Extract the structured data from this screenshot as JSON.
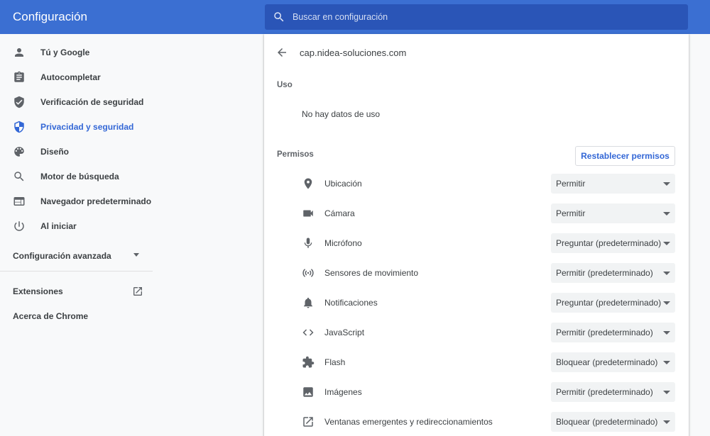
{
  "header": {
    "title": "Configuración",
    "search_placeholder": "Buscar en configuración"
  },
  "sidebar": {
    "items": [
      {
        "label": "Tú y Google",
        "icon": "person-icon"
      },
      {
        "label": "Autocompletar",
        "icon": "clipboard-icon"
      },
      {
        "label": "Verificación de seguridad",
        "icon": "shield-check-icon"
      },
      {
        "label": "Privacidad y seguridad",
        "icon": "shield-privacy-icon",
        "active": true
      },
      {
        "label": "Diseño",
        "icon": "palette-icon"
      },
      {
        "label": "Motor de búsqueda",
        "icon": "search-icon"
      },
      {
        "label": "Navegador predeterminado",
        "icon": "browser-icon"
      },
      {
        "label": "Al iniciar",
        "icon": "power-icon"
      }
    ],
    "advanced": "Configuración avanzada",
    "extensions": "Extensiones",
    "about": "Acerca de Chrome"
  },
  "main": {
    "site": "cap.nidea-soluciones.com",
    "usage_title": "Uso",
    "usage_text": "No hay datos de uso",
    "permissions_title": "Permisos",
    "reset_label": "Restablecer permisos",
    "permissions": [
      {
        "label": "Ubicación",
        "value": "Permitir",
        "icon": "location-icon"
      },
      {
        "label": "Cámara",
        "value": "Permitir",
        "icon": "camera-icon"
      },
      {
        "label": "Micrófono",
        "value": "Preguntar (predeterminado)",
        "icon": "microphone-icon"
      },
      {
        "label": "Sensores de movimiento",
        "value": "Permitir (predeterminado)",
        "icon": "sensors-icon"
      },
      {
        "label": "Notificaciones",
        "value": "Preguntar (predeterminado)",
        "icon": "bell-icon"
      },
      {
        "label": "JavaScript",
        "value": "Permitir (predeterminado)",
        "icon": "code-icon"
      },
      {
        "label": "Flash",
        "value": "Bloquear (predeterminado)",
        "icon": "puzzle-icon"
      },
      {
        "label": "Imágenes",
        "value": "Permitir (predeterminado)",
        "icon": "image-icon"
      },
      {
        "label": "Ventanas emergentes y redireccionamientos",
        "value": "Bloquear (predeterminado)",
        "icon": "open-in-new-icon"
      }
    ]
  },
  "colors": {
    "header_bg": "#3b6fd2",
    "search_bg": "#2a55b7",
    "accent": "#3367d6"
  }
}
